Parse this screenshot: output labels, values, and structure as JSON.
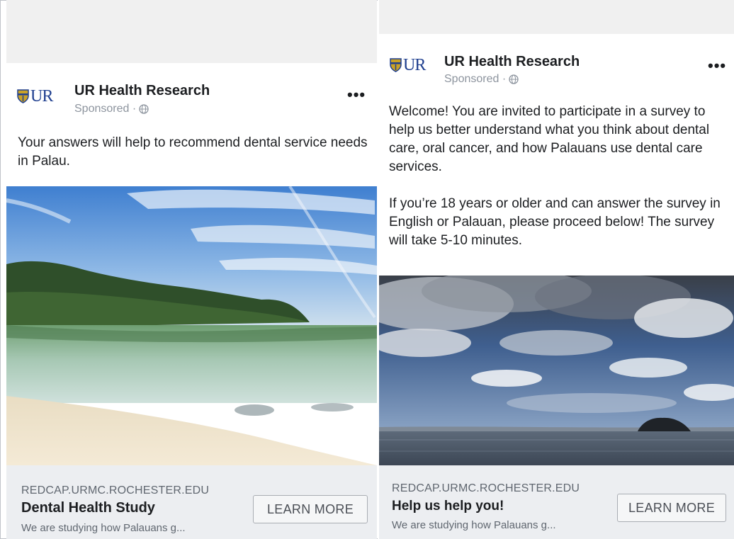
{
  "colors": {
    "brand_blue": "#1f3f8f",
    "brand_gold": "#c9a227",
    "footer_bg": "#eceef1",
    "muted_text": "#606770"
  },
  "ads": [
    {
      "page_name": "UR Health Research",
      "logo_text": "UR",
      "sponsored": "Sponsored ·",
      "more_icon": "more-options-icon",
      "more_glyph": "•••",
      "text_paragraphs": [
        "Your answers will help to recommend dental service needs in Palau."
      ],
      "footer": {
        "domain": "REDCAP.URMC.ROCHESTER.EDU",
        "headline": "Dental Health Study",
        "description": "We are studying how Palauans g...",
        "cta": "LEARN MORE"
      }
    },
    {
      "page_name": "UR Health Research",
      "logo_text": "UR",
      "sponsored": "Sponsored ·",
      "more_icon": "more-options-icon",
      "more_glyph": "•••",
      "text_paragraphs": [
        "Welcome! You are invited to participate in a survey to help us better understand what you think about dental care, oral cancer, and how Palauans use dental care services.",
        "If you’re 18 years or older and can answer the survey in English or Palauan, please proceed below! The survey will take 5-10 minutes."
      ],
      "footer": {
        "domain": "REDCAP.URMC.ROCHESTER.EDU",
        "headline": "Help us help you!",
        "description": "We are studying how Palauans g...",
        "cta": "LEARN MORE"
      }
    }
  ]
}
